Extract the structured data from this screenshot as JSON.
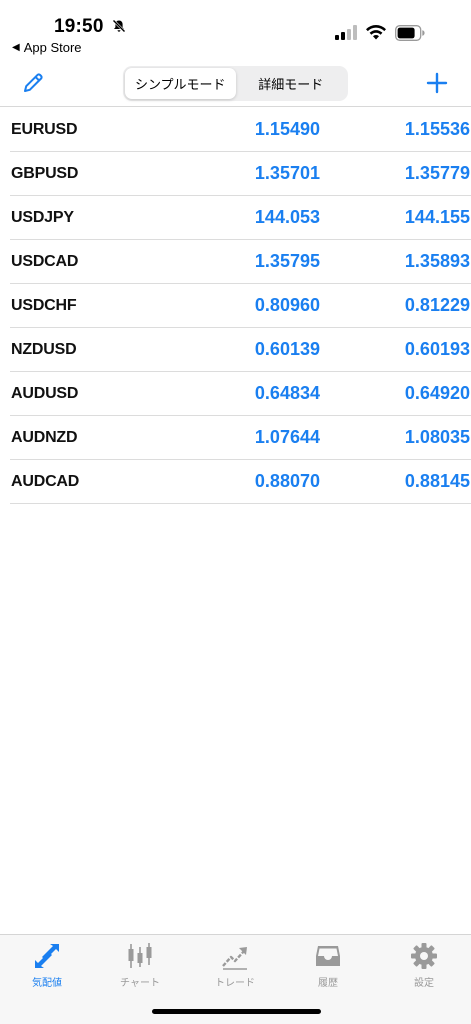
{
  "status_bar": {
    "time": "19:50",
    "back_label": "App Store",
    "icons": [
      "bell-slash-icon",
      "cellular-signal-icon",
      "wifi-icon",
      "battery-icon"
    ]
  },
  "nav": {
    "edit_icon": "pencil-icon",
    "add_icon": "plus-icon",
    "segments": [
      {
        "label": "シンプルモード",
        "active": true
      },
      {
        "label": "詳細モード",
        "active": false
      }
    ],
    "accent_color": "#1a7ff0"
  },
  "quotes": [
    {
      "symbol": "EURUSD",
      "bid": "1.15490",
      "ask": "1.15536"
    },
    {
      "symbol": "GBPUSD",
      "bid": "1.35701",
      "ask": "1.35779"
    },
    {
      "symbol": "USDJPY",
      "bid": "144.053",
      "ask": "144.155"
    },
    {
      "symbol": "USDCAD",
      "bid": "1.35795",
      "ask": "1.35893"
    },
    {
      "symbol": "USDCHF",
      "bid": "0.80960",
      "ask": "0.81229"
    },
    {
      "symbol": "NZDUSD",
      "bid": "0.60139",
      "ask": "0.60193"
    },
    {
      "symbol": "AUDUSD",
      "bid": "0.64834",
      "ask": "0.64920"
    },
    {
      "symbol": "AUDNZD",
      "bid": "1.07644",
      "ask": "1.08035"
    },
    {
      "symbol": "AUDCAD",
      "bid": "0.88070",
      "ask": "0.88145"
    }
  ],
  "tabs": [
    {
      "label": "気配値",
      "icon": "quotes-arrows-icon",
      "active": true
    },
    {
      "label": "チャート",
      "icon": "candlestick-chart-icon",
      "active": false
    },
    {
      "label": "トレード",
      "icon": "trade-trend-icon",
      "active": false
    },
    {
      "label": "履歴",
      "icon": "history-inbox-icon",
      "active": false
    },
    {
      "label": "設定",
      "icon": "settings-gear-icon",
      "active": false
    }
  ]
}
